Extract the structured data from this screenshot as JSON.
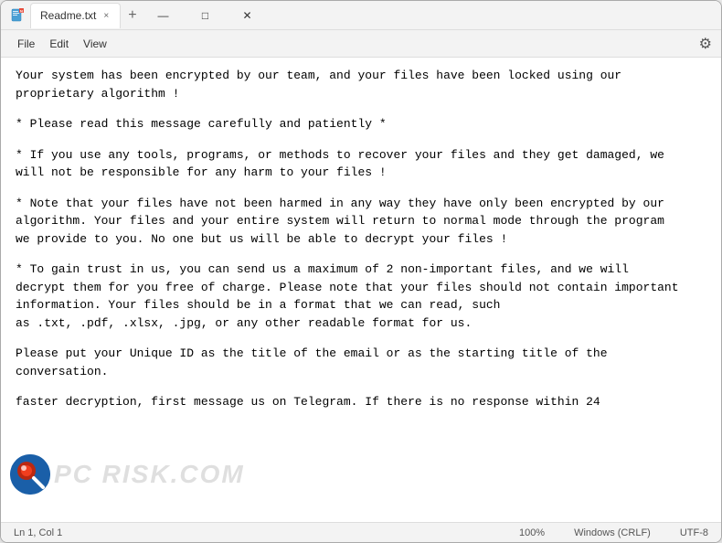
{
  "window": {
    "title": "Readme.txt",
    "icon": "notepad-icon",
    "tab_close": "×",
    "tab_new": "+",
    "btn_minimize": "—",
    "btn_maximize": "□",
    "btn_close": "✕"
  },
  "menu": {
    "items": [
      "File",
      "Edit",
      "View"
    ],
    "gear_icon": "⚙"
  },
  "content": {
    "paragraphs": [
      "Your system has been encrypted by our team, and your files have been locked using our\nproprietary algorithm !",
      "* Please read this message carefully and patiently *",
      "* If you use any tools, programs, or methods to recover your files and they get damaged, we\nwill not be responsible for any harm to your files !",
      "* Note that your files have not been harmed in any way they have only been encrypted by our\nalgorithm. Your files and your entire system will return to normal mode through the program\nwe provide to you. No one but us will be able to decrypt your files !",
      "* To gain trust in us, you can send us a maximum of 2 non-important files, and we will\ndecrypt them for you free of charge. Please note that your files should not contain important\ninformation. Your files should be in a format that we can read, such\nas .txt, .pdf, .xlsx, .jpg, or any other readable format for us.",
      "Please put your Unique ID as the title of the email or as the starting title of the\nconversation.",
      "faster decryption, first message us on Telegram. If there is no response within 24"
    ]
  },
  "status": {
    "position": "Ln 1, Col 1",
    "zoom": "100%",
    "line_ending": "Windows (CRLF)",
    "encoding": "UTF-8"
  },
  "watermark": {
    "text": "PC RISK.COM"
  }
}
